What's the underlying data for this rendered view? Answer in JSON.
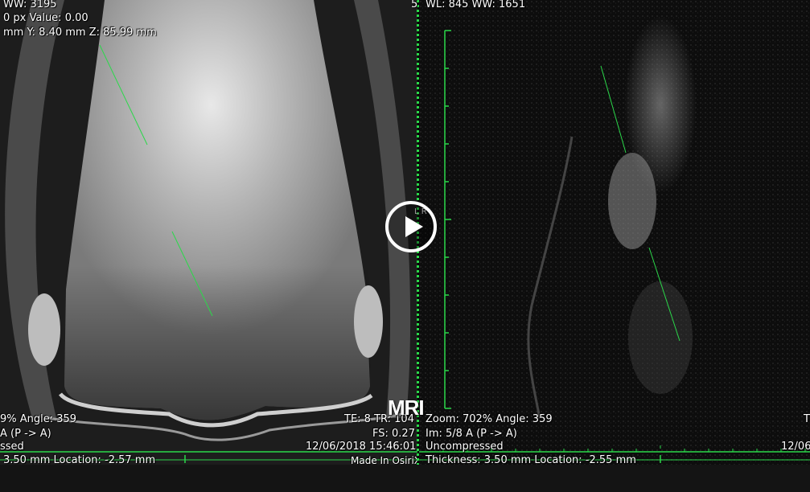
{
  "left_view": {
    "window_width": "WW: 3195",
    "pixel_value": "0 px  Value: 0.00",
    "position": "mm Y: 8.40 mm Z: 85.99 mm",
    "zoom_angle": "9%  Angle: 359",
    "orientation": "A (P -> A)",
    "compression": "ssed",
    "thickness_location": "3.50 mm Location: -2.57 mm",
    "te_tr": "TE:  8 TR:  104",
    "fs": "FS:  0.27",
    "datetime": "12/06/2018 15:46:01",
    "made_in": "Made In OsiriX"
  },
  "divider_label": "5",
  "right_view": {
    "wl_ww": "WL: 845 WW: 1651",
    "zoom_angle": "Zoom: 702%  Angle: 359",
    "image_index": "Im: 5/8   A (P -> A)",
    "compression": "Uncompressed",
    "thickness_location": "Thickness: 3.50 mm Location: -2.55 mm",
    "te_partial": "T",
    "date_partial": "12/06"
  },
  "orientation_marker": "L R",
  "watermark": "MRI",
  "play_icon": "play-icon",
  "colors": {
    "overlay_green": "#2bd84a",
    "text": "#ffffff"
  }
}
